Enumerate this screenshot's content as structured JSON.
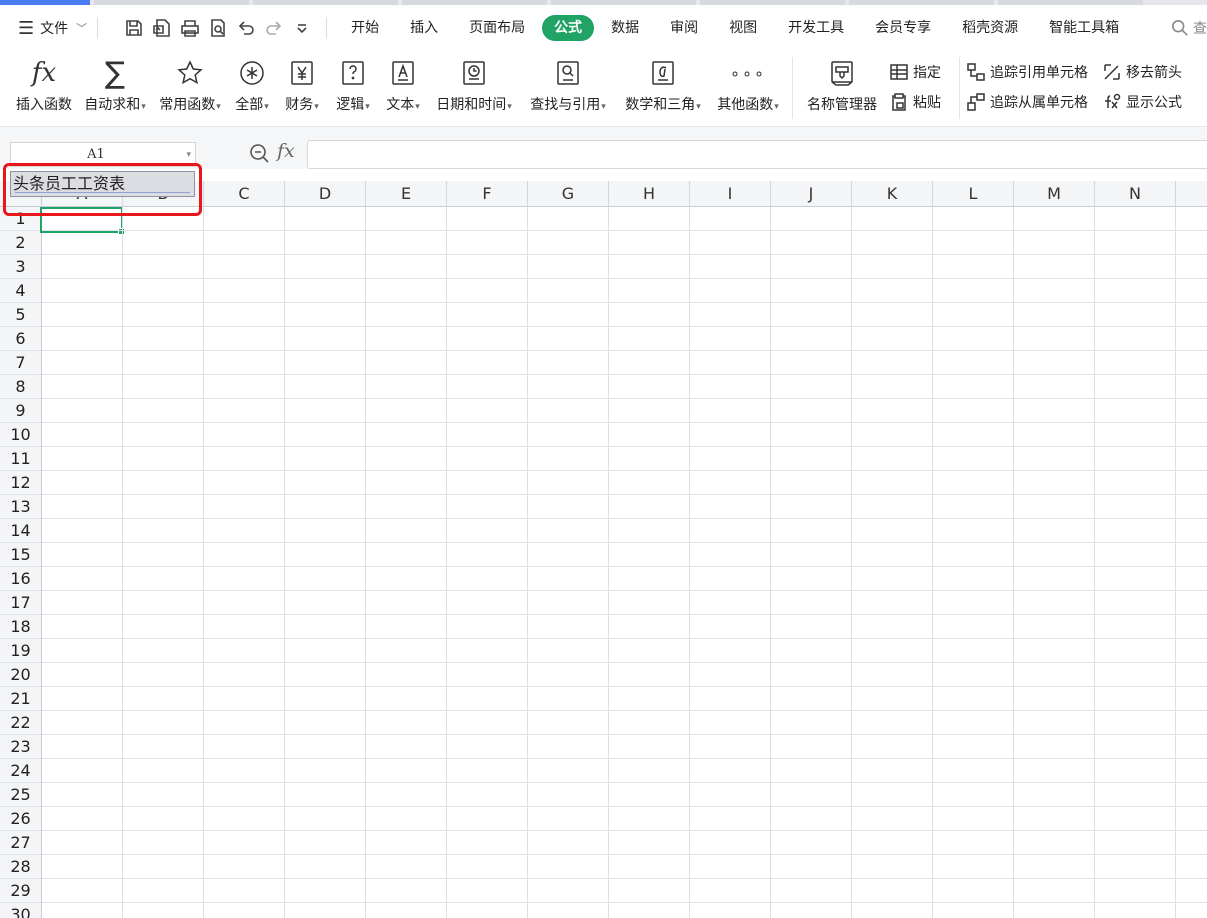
{
  "menu": {
    "file_label": "文件",
    "tabs": [
      "开始",
      "插入",
      "页面布局",
      "公式",
      "数据",
      "审阅",
      "视图",
      "开发工具",
      "会员专享",
      "稻壳资源",
      "智能工具箱"
    ],
    "active_tab": "公式",
    "search_label": "查"
  },
  "ribbon": {
    "big_buttons": [
      {
        "label": "插入函数",
        "dropdown": false,
        "icon": "fx-icon"
      },
      {
        "label": "自动求和",
        "dropdown": true,
        "icon": "sigma-icon"
      },
      {
        "label": "常用函数",
        "dropdown": true,
        "icon": "star-icon"
      },
      {
        "label": "全部",
        "dropdown": true,
        "icon": "asterisk-icon"
      },
      {
        "label": "财务",
        "dropdown": true,
        "icon": "yen-icon"
      },
      {
        "label": "逻辑",
        "dropdown": true,
        "icon": "question-book-icon"
      },
      {
        "label": "文本",
        "dropdown": true,
        "icon": "text-book-icon"
      },
      {
        "label": "日期和时间",
        "dropdown": true,
        "icon": "clock-book-icon"
      },
      {
        "label": "查找与引用",
        "dropdown": true,
        "icon": "search-book-icon"
      },
      {
        "label": "数学和三角",
        "dropdown": true,
        "icon": "math-book-icon"
      },
      {
        "label": "其他函数",
        "dropdown": true,
        "icon": "more-dots-icon"
      }
    ],
    "name_manager": "名称管理器",
    "specify": "指定",
    "paste": "粘贴",
    "trace_precedents": "追踪引用单元格",
    "trace_dependents": "追踪从属单元格",
    "remove_arrows": "移去箭头",
    "show_formulas": "显示公式"
  },
  "formula_bar": {
    "name_box": "A1",
    "fx_label": "fx",
    "value": ""
  },
  "sheet": {
    "columns": [
      "A",
      "B",
      "C",
      "D",
      "E",
      "F",
      "G",
      "H",
      "I",
      "J",
      "K",
      "L",
      "M",
      "N"
    ],
    "rows": [
      "1",
      "2",
      "3",
      "4",
      "5",
      "6",
      "7",
      "8",
      "9",
      "10",
      "11",
      "12",
      "13",
      "14",
      "15",
      "16",
      "17",
      "18",
      "19",
      "20",
      "21",
      "22",
      "23",
      "24",
      "25",
      "26",
      "27",
      "28",
      "29",
      "30"
    ],
    "selected_cell": "A1"
  },
  "tooltip": {
    "text": "头条员工工资表"
  },
  "colors": {
    "accent": "#21a366",
    "highlight": "#e8171c",
    "tab_strip_active": "#4a7cf3"
  }
}
